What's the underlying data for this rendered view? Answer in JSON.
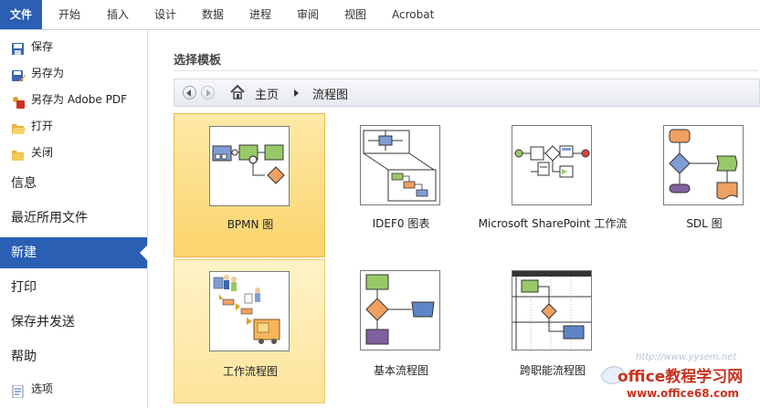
{
  "ribbon": {
    "tabs": [
      "文件",
      "开始",
      "插入",
      "设计",
      "数据",
      "进程",
      "审阅",
      "视图",
      "Acrobat"
    ]
  },
  "sidebar": {
    "small_items": [
      {
        "label": "保存",
        "icon": "save-icon"
      },
      {
        "label": "另存为",
        "icon": "save-as-icon"
      },
      {
        "label": "另存为 Adobe PDF",
        "icon": "pdf-icon"
      },
      {
        "label": "打开",
        "icon": "open-folder-icon"
      },
      {
        "label": "关闭",
        "icon": "close-folder-icon"
      }
    ],
    "big_items": [
      "信息",
      "最近所用文件",
      "新建",
      "打印",
      "保存并发送",
      "帮助"
    ],
    "active": "新建",
    "options": {
      "label": "选项",
      "icon": "options-icon"
    }
  },
  "main": {
    "section_title": "选择模板",
    "breadcrumb": {
      "home": "主页",
      "current": "流程图"
    },
    "templates": [
      {
        "label": "BPMN 图",
        "state": "selected"
      },
      {
        "label": "IDEF0 图表",
        "state": "normal"
      },
      {
        "label": "Microsoft SharePoint 工作流",
        "state": "normal"
      },
      {
        "label": "SDL 图",
        "state": "normal"
      },
      {
        "label": "工作流程图",
        "state": "hover"
      },
      {
        "label": "基本流程图",
        "state": "normal"
      },
      {
        "label": "跨职能流程图",
        "state": "normal"
      }
    ]
  },
  "watermark": {
    "url_top": "http://www.yysem.net",
    "brand": "office教程学习网",
    "url_bottom": "www.office68.com"
  },
  "colors": {
    "accent": "#2a5fb4",
    "tile_selected": "#fbd46a",
    "tile_hover": "#fde49a",
    "watermark_red": "#c8321e"
  }
}
